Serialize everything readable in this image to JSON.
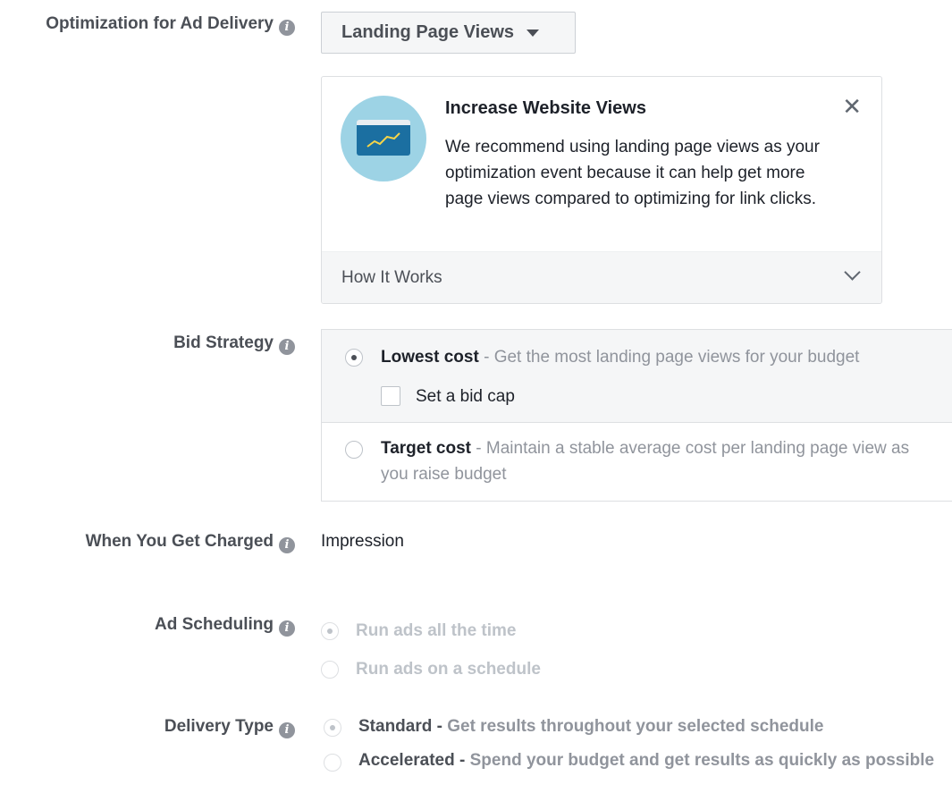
{
  "optimization": {
    "label": "Optimization for Ad Delivery",
    "selected": "Landing Page Views"
  },
  "recommendation": {
    "title": "Increase Website Views",
    "body": "We recommend using landing page views as your optimization event because it can help get more page views compared to optimizing for link clicks.",
    "footer": "How It Works",
    "close_symbol": "✕"
  },
  "bid_strategy": {
    "label": "Bid Strategy",
    "options": [
      {
        "title": "Lowest cost",
        "desc": " - Get the most landing page views for your budget",
        "selected": true
      },
      {
        "title": "Target cost",
        "desc": " - Maintain a stable average cost per landing page view as you raise budget",
        "selected": false
      }
    ],
    "bid_cap_label": "Set a bid cap"
  },
  "charged": {
    "label": "When You Get Charged",
    "value": "Impression"
  },
  "scheduling": {
    "label": "Ad Scheduling",
    "options": [
      "Run ads all the time",
      "Run ads on a schedule"
    ]
  },
  "delivery": {
    "label": "Delivery Type",
    "options": [
      {
        "title": "Standard -",
        "desc": " Get results throughout your selected schedule"
      },
      {
        "title": "Accelerated -",
        "desc": " Spend your budget and get results as quickly as possible"
      }
    ]
  },
  "info_symbol": "i",
  "colors": {
    "accent_bg": "#f5f6f7",
    "border": "#dddfe2",
    "muted_text": "#90949c",
    "illustration_circle": "#9dd3e5",
    "illustration_screen": "#1b6fa1",
    "trend_line": "#f7d548"
  }
}
